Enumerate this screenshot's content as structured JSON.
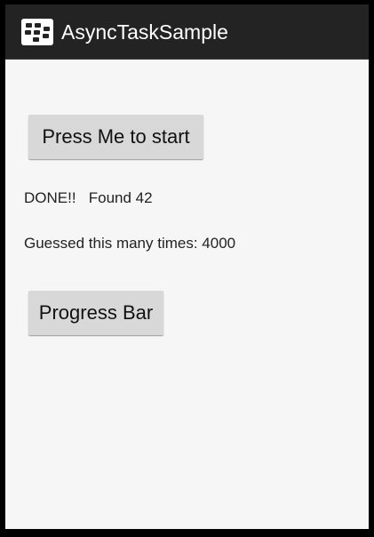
{
  "app": {
    "title": "AsyncTaskSample",
    "icon": "blackberry-logo-icon"
  },
  "buttons": {
    "start_label": "Press Me to start",
    "progress_label": "Progress Bar"
  },
  "status": {
    "result_text": "DONE!!   Found 42",
    "guesses_text": "Guessed this many times: 4000"
  },
  "colors": {
    "action_bar": "#232323",
    "background": "#f6f6f6",
    "button": "#d8d8d8"
  }
}
